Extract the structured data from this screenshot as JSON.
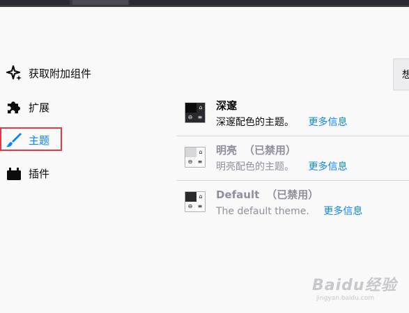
{
  "sidebar": {
    "items": [
      {
        "label": "获取附加组件",
        "icon": "sparkle-icon"
      },
      {
        "label": "扩展",
        "icon": "puzzle-icon"
      },
      {
        "label": "主题",
        "icon": "brush-icon",
        "selected": true
      },
      {
        "label": "插件",
        "icon": "plugin-icon"
      }
    ]
  },
  "right_button": {
    "label": "想"
  },
  "themes": [
    {
      "name": "深邃",
      "status": "",
      "description": "深邃配色的主题。",
      "more": "更多信息",
      "enabled": true
    },
    {
      "name": "明亮",
      "status": "（已禁用）",
      "description": "明亮配色的主题。",
      "more": "更多信息",
      "enabled": false
    },
    {
      "name": "Default",
      "status": "（已禁用）",
      "description": "The default theme.",
      "more": "更多信息",
      "enabled": false
    }
  ],
  "watermark": {
    "brand": "Baidu经验",
    "url": "jingyan.baidu.com"
  },
  "colors": {
    "accent": "#0a84ff",
    "highlight_box": "#e8363f",
    "background": "#f9f9fa",
    "dark_theme": "#2a2a2e"
  }
}
